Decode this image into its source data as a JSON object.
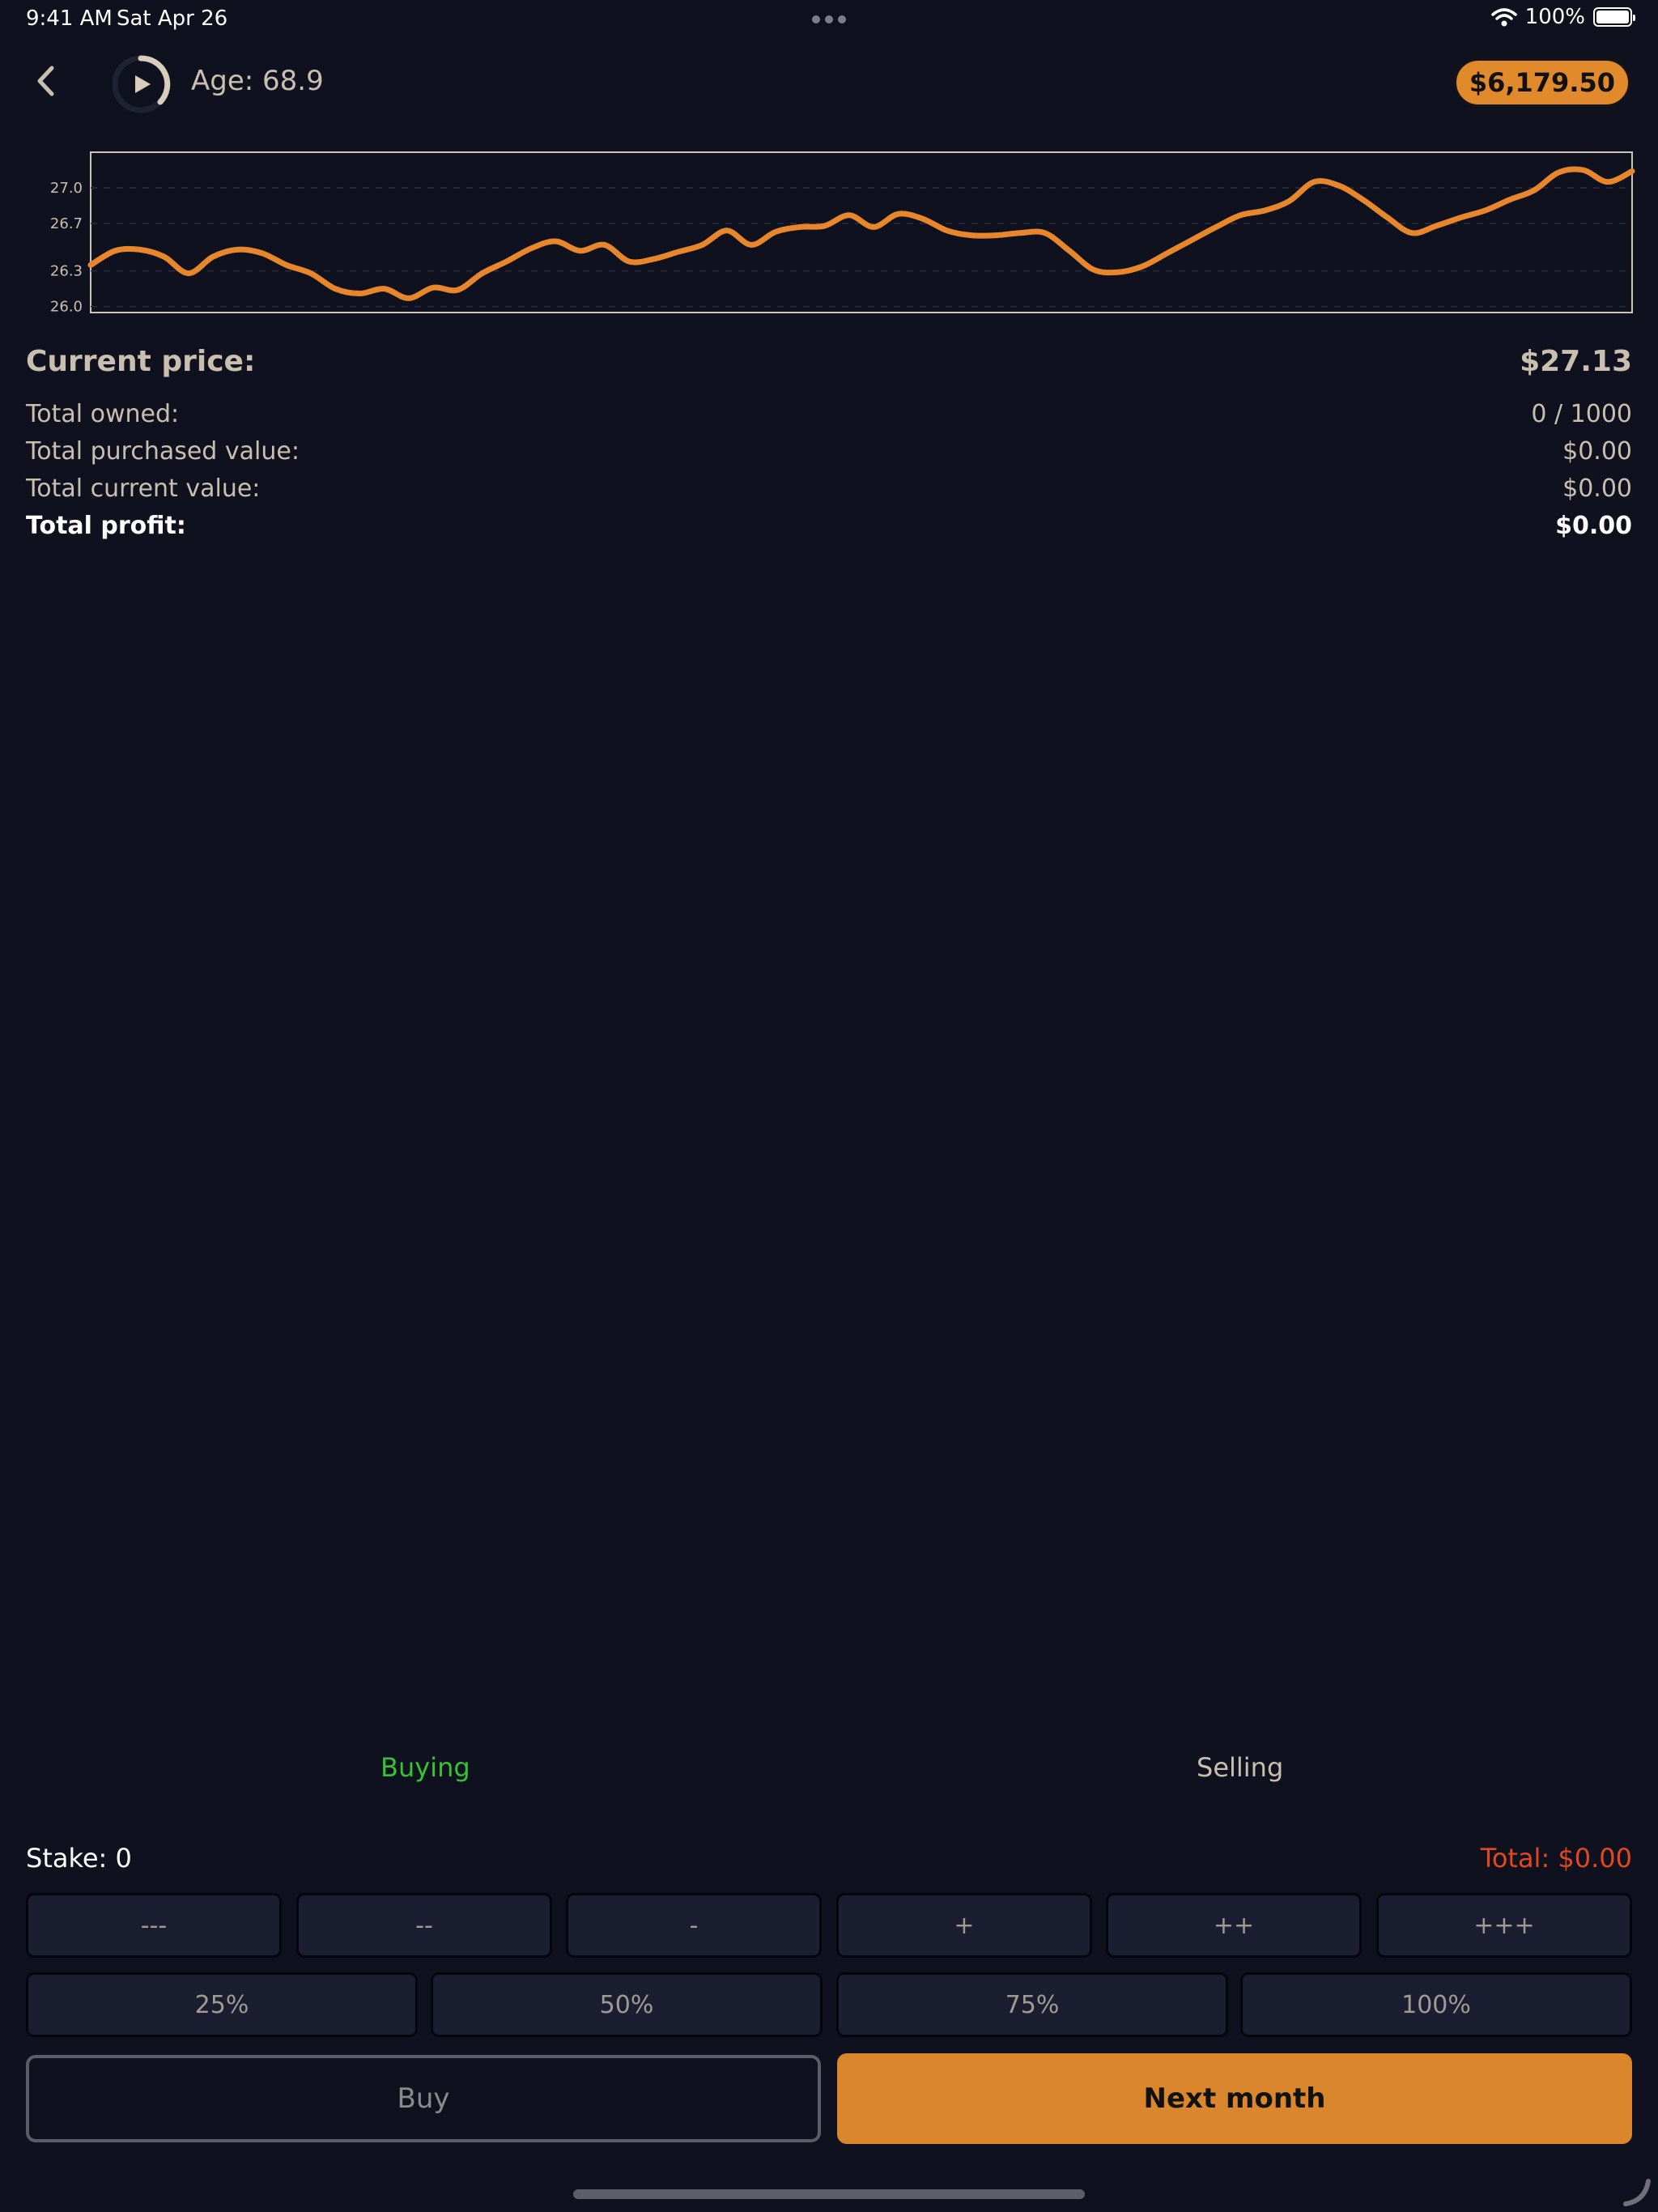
{
  "status_bar": {
    "time": "9:41 AM",
    "date": "Sat Apr 26",
    "battery": "100%"
  },
  "header": {
    "age": "Age: 68.9",
    "balance": "$6,179.50"
  },
  "chart_data": {
    "type": "line",
    "title": "",
    "xlabel": "",
    "ylabel": "",
    "ylim": [
      25.95,
      27.3
    ],
    "ytick_values": [
      26.0,
      26.3,
      26.7,
      27.0
    ],
    "yticks": [
      "26.0",
      "26.3",
      "26.7",
      "27.0"
    ],
    "grid": true,
    "color": "#e8862b",
    "x": [
      0,
      1,
      2,
      3,
      4,
      5,
      6,
      7,
      8,
      9,
      10,
      11,
      12,
      13,
      14,
      15,
      16,
      17,
      18,
      19,
      20,
      21,
      22,
      23,
      24,
      25,
      26,
      27,
      28,
      29,
      30,
      31,
      32,
      33,
      34,
      35,
      36,
      37,
      38,
      39,
      40,
      41,
      42,
      43,
      44,
      45,
      46,
      47,
      48,
      49,
      50,
      51,
      52,
      53,
      54,
      55,
      56,
      57,
      58,
      59,
      60,
      61,
      62,
      63,
      64,
      65,
      66,
      67,
      68,
      69,
      70,
      71,
      72,
      73,
      74,
      75,
      76,
      77,
      78,
      79,
      80,
      81,
      82,
      83,
      84,
      85,
      86,
      87,
      88,
      89,
      90,
      91,
      92,
      93,
      94,
      95,
      96,
      97,
      98,
      99,
      100
    ],
    "values": [
      26.35,
      26.47,
      26.48,
      26.42,
      26.28,
      26.42,
      26.48,
      26.45,
      26.35,
      26.28,
      26.15,
      26.11,
      26.15,
      26.07,
      26.16,
      26.14,
      26.28,
      26.38,
      26.49,
      26.55,
      26.47,
      26.52,
      26.38,
      26.4,
      26.46,
      26.52,
      26.64,
      26.52,
      26.63,
      26.67,
      26.68,
      26.77,
      26.67,
      26.78,
      26.74,
      26.64,
      26.6,
      26.6,
      26.62,
      26.62,
      26.47,
      26.31,
      26.29,
      26.34,
      26.45,
      26.56,
      26.67,
      26.77,
      26.81,
      26.89,
      27.05,
      27.02,
      26.9,
      26.75,
      26.62,
      26.68,
      26.75,
      26.81,
      26.9,
      26.98,
      27.13,
      27.15,
      27.05,
      27.14
    ]
  },
  "stats": {
    "current_price_label": "Current price:",
    "current_price": "$27.13",
    "owned_label": "Total owned:",
    "owned": "0 / 1000",
    "purchased_label": "Total purchased value:",
    "purchased": "$0.00",
    "current_value_label": "Total current value:",
    "current_value": "$0.00",
    "profit_label": "Total profit:",
    "profit": "$0.00"
  },
  "tabs": {
    "buying": "Buying",
    "selling": "Selling"
  },
  "stake": "Stake: 0",
  "total": "Total: $0.00",
  "stake_buttons": [
    "---",
    "--",
    "-",
    "+",
    "++",
    "+++"
  ],
  "percent_buttons": [
    "25%",
    "50%",
    "75%",
    "100%"
  ],
  "actions": {
    "buy": "Buy",
    "next_month": "Next month"
  }
}
